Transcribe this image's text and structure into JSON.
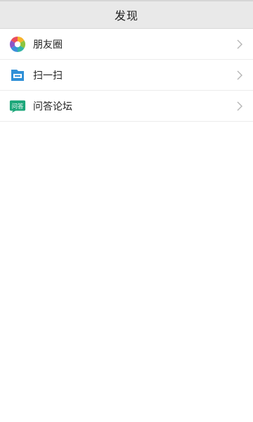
{
  "header": {
    "title": "发现"
  },
  "list": {
    "items": [
      {
        "label": "朋友圈",
        "icon": "aperture-icon"
      },
      {
        "label": "扫一扫",
        "icon": "scan-icon"
      },
      {
        "label": "问答论坛",
        "icon": "forum-icon",
        "icon_text": "问答"
      }
    ]
  },
  "colors": {
    "header_bg": "#e9e9e9",
    "divider": "#ececec",
    "scan_blue": "#2f90d7",
    "forum_green": "#1ca77a"
  }
}
